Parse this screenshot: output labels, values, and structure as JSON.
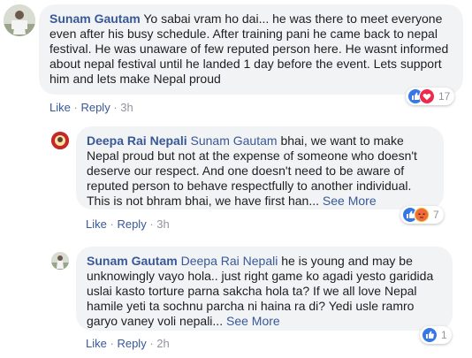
{
  "comments": [
    {
      "author": "Sunam Gautam",
      "mention": "",
      "text": "Yo sabai vram ho dai... he was there to meet everyone even after his busy schedule. After training pani he came back to nepal festival. He was unaware of few reputed person here. He wasnt informed about nepal festival until he landed 1 day before the event. Lets support him and lets make Nepal proud",
      "see_more": "",
      "like": "Like",
      "reply": "Reply",
      "time": "3h",
      "reaction_count": "17",
      "reactions": [
        "like-icon",
        "love-icon"
      ]
    },
    {
      "author": "Deepa Rai Nepali",
      "mention": "Sunam Gautam",
      "text": "bhai, we want to make Nepal proud but not at the expense of someone who doesn't deserve our respect. And one doesn't need to be aware of reputed person to behave respectfully to another individual. This is not bhram bhai, we have first han...",
      "see_more": "See More",
      "like": "Like",
      "reply": "Reply",
      "time": "3h",
      "reaction_count": "7",
      "reactions": [
        "like-icon",
        "angry-icon"
      ]
    },
    {
      "author": "Sunam Gautam",
      "mention": "Deepa Rai Nepali",
      "text": "he is young and may be unknowingly vayo hola.. just right game ko agadi yesto garidida uslai kasto torture parna sakcha hola ta? If we all love Nepal hamile yeti ta sochnu parcha ni haina ra di? Yedi usle ramro garyo vaney voli nepali...",
      "see_more": "See More",
      "like": "Like",
      "reply": "Reply",
      "time": "2h",
      "reaction_count": "1",
      "reactions": [
        "like-icon"
      ]
    }
  ],
  "colors": {
    "link": "#385898",
    "bubble": "#f2f3f5",
    "meta": "#90949c",
    "like": "#3578e5",
    "love": "#f0284a",
    "angry": "#f7b125"
  }
}
